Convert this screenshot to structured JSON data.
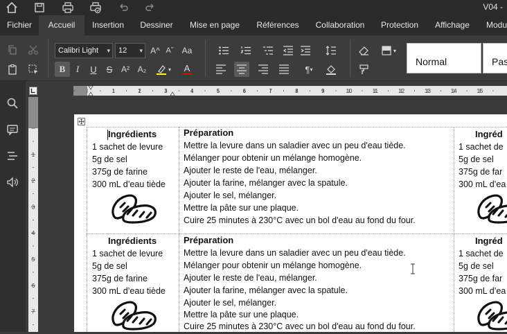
{
  "document": {
    "title": "V04 -"
  },
  "menu": {
    "tabs": [
      {
        "label": "Fichier"
      },
      {
        "label": "Accueil"
      },
      {
        "label": "Insertion"
      },
      {
        "label": "Dessiner"
      },
      {
        "label": "Mise en page"
      },
      {
        "label": "Références"
      },
      {
        "label": "Collaboration"
      },
      {
        "label": "Protection"
      },
      {
        "label": "Affichage"
      },
      {
        "label": "Modu"
      }
    ],
    "active": "Accueil"
  },
  "ribbon": {
    "font_name": "Calibri Light",
    "font_size": "12",
    "bold": "B",
    "italic": "I",
    "underline": "U",
    "strike": "S",
    "superscript": "A²",
    "subscript": "A₂",
    "grow_font": "A^",
    "shrink_font": "Aˇ",
    "change_case": "Aa",
    "font_color_letter": "A",
    "highlight_letter": "A",
    "styles": [
      "Normal",
      "Pas"
    ],
    "highlight_color": "#ffff00",
    "font_color": "#e00000"
  },
  "ruler": {
    "h_numbers": [
      "1",
      "2",
      "3",
      "4",
      "5",
      "6",
      "7",
      "8",
      "9",
      "10",
      "11",
      "12",
      "13",
      "14",
      "15"
    ],
    "v_numbers": [
      "1",
      "2",
      "3",
      "4",
      "5",
      "6",
      "7",
      "8"
    ]
  },
  "table": {
    "rows": [
      {
        "ingredients_title": "Ingrédients",
        "ingredients": [
          "1 sachet de levure",
          "5g de sel",
          "375g de farine",
          "300 mL d’eau tiède"
        ],
        "preparation_title": "Préparation",
        "steps": [
          "Mettre la levure dans un saladier avec un peu d'eau tiède.",
          "Mélanger pour obtenir un mélange homogène.",
          "Ajouter le reste de l'eau, mélanger.",
          "Ajouter la farine, mélanger avec la spatule.",
          "Ajouter le sel, mélanger.",
          "Mettre la pâte sur une plaque.",
          "Cuire 25 minutes à 230°C avec un bol d'eau au fond du four."
        ],
        "next_col_title": "Ingréd",
        "next_col_items": [
          "1 sachet de",
          "5g de sel",
          "375g de far",
          "300 mL d’ea"
        ]
      },
      {
        "ingredients_title": "Ingrédients",
        "ingredients": [
          "1 sachet de levure",
          "5g de sel",
          "375g de farine",
          "300 mL d’eau tiède"
        ],
        "preparation_title": "Préparation",
        "steps": [
          "Mettre la levure dans un saladier avec un peu d'eau tiède.",
          "Mélanger pour obtenir un mélange homogène.",
          "Ajouter le reste de l'eau, mélanger.",
          "Ajouter la farine, mélanger avec la spatule.",
          "Ajouter le sel, mélanger.",
          "Mettre la pâte sur une plaque.",
          "Cuire 25 minutes à 230°C avec un bol d'eau au fond du four."
        ],
        "next_col_title": "Ingréd",
        "next_col_items": [
          "1 sachet de",
          "5g de sel",
          "375g de far",
          "300 mL d’ea"
        ]
      }
    ]
  },
  "icons": {
    "titlebar": [
      "home-icon",
      "save-icon",
      "print-icon",
      "quick-print-icon",
      "undo-icon",
      "redo-icon"
    ],
    "leftbar": [
      "search-icon",
      "comments-icon",
      "navigation-icon",
      "speaker-icon"
    ]
  }
}
